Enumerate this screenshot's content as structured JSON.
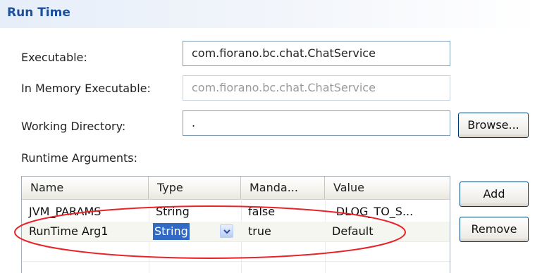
{
  "section": {
    "title": "Run Time"
  },
  "form": {
    "executable_label": "Executable:",
    "executable_value": "com.fiorano.bc.chat.ChatService",
    "in_memory_label": "In Memory Executable:",
    "in_memory_value": "com.fiorano.bc.chat.ChatService",
    "working_dir_label": "Working Directory:",
    "working_dir_value": ".",
    "browse_label": "Browse...",
    "runtime_args_label": "Runtime Arguments:"
  },
  "table": {
    "columns": [
      "Name",
      "Type",
      "Manda...",
      "Value"
    ],
    "rows": [
      {
        "name": "JVM_PARAMS",
        "type": "String",
        "mandatory": "false",
        "value": "-DLOG_TO_S..."
      },
      {
        "name": "RunTime Arg1",
        "type": "String",
        "mandatory": "true",
        "value": "Default"
      }
    ]
  },
  "buttons": {
    "add_label": "Add",
    "remove_label": "Remove"
  },
  "icons": {
    "dropdown": "chevron-down-icon"
  },
  "colors": {
    "section_title": "#1d4f9a",
    "selection": "#316ac5",
    "annotation": "#e8232a"
  }
}
